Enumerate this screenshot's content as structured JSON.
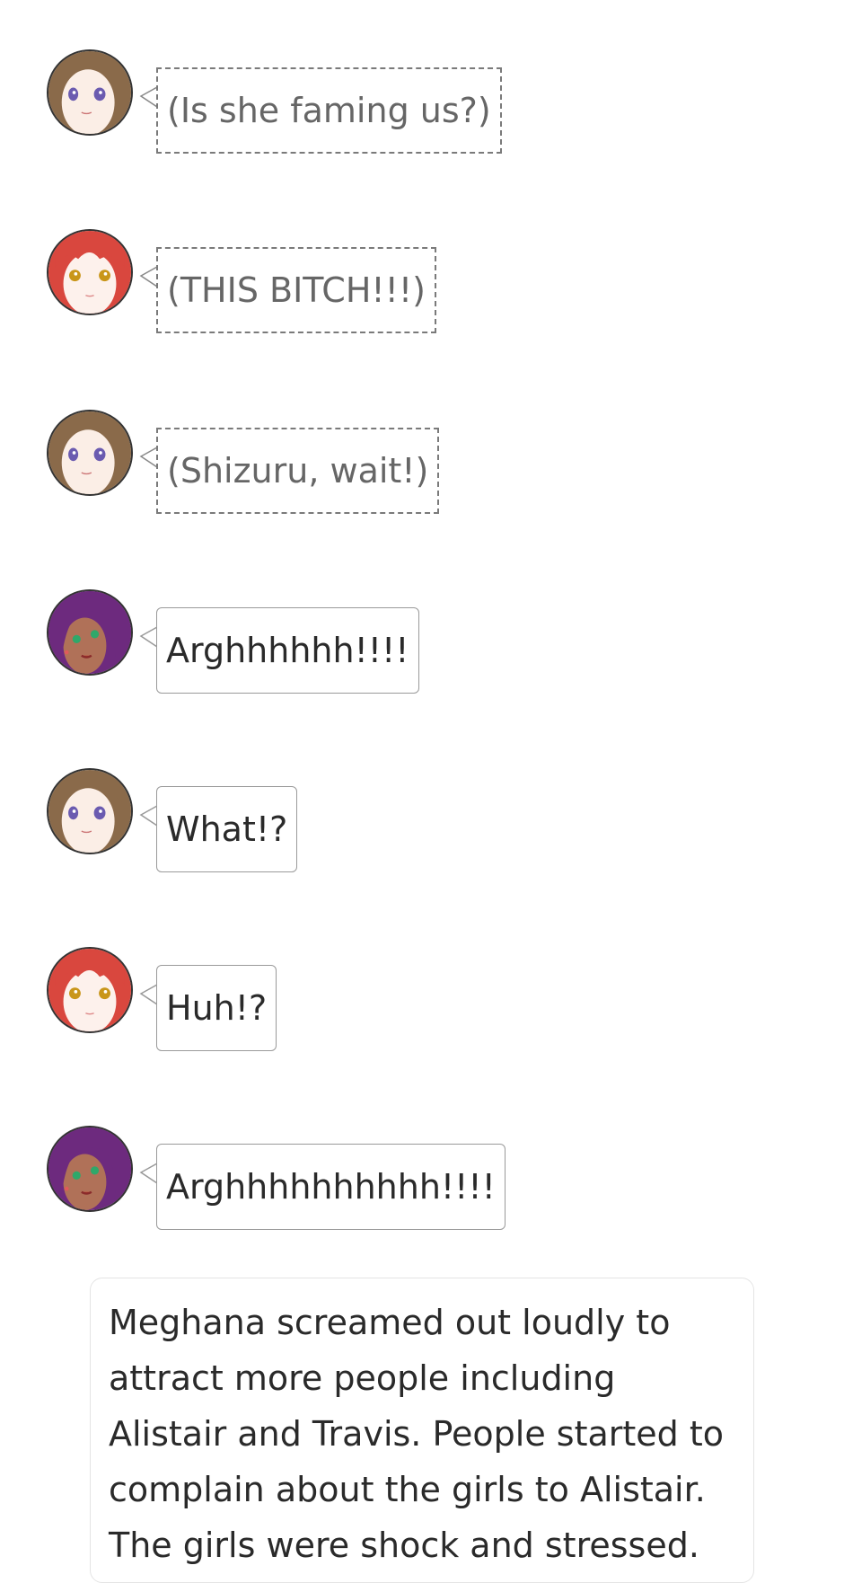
{
  "messages": [
    {
      "character": "brown-haired-girl",
      "type": "thought",
      "text": "(Is she faming us?)"
    },
    {
      "character": "red-haired-girl",
      "type": "thought",
      "text": "(THIS BITCH!!!)"
    },
    {
      "character": "brown-haired-girl",
      "type": "thought",
      "text": "(Shizuru, wait!)"
    },
    {
      "character": "purple-haired-girl",
      "type": "speech",
      "text": "Arghhhhhh!!!!"
    },
    {
      "character": "brown-haired-girl",
      "type": "speech",
      "text": "What!?"
    },
    {
      "character": "red-haired-girl",
      "type": "speech",
      "text": "Huh!?"
    },
    {
      "character": "purple-haired-girl",
      "type": "speech",
      "text": "Arghhhhhhhhhh!!!!"
    }
  ],
  "narration": {
    "text": "Meghana screamed out loudly to attract more people including Alistair and Travis. People started to complain about the girls to Alistair. The girls were shock and stressed."
  },
  "colors": {
    "thought_text": "#666666",
    "speech_text": "#2a2a2a",
    "brown_hair": "#8a6a4a",
    "red_hair": "#d9473e",
    "purple_hair": "#6d2a7e"
  }
}
